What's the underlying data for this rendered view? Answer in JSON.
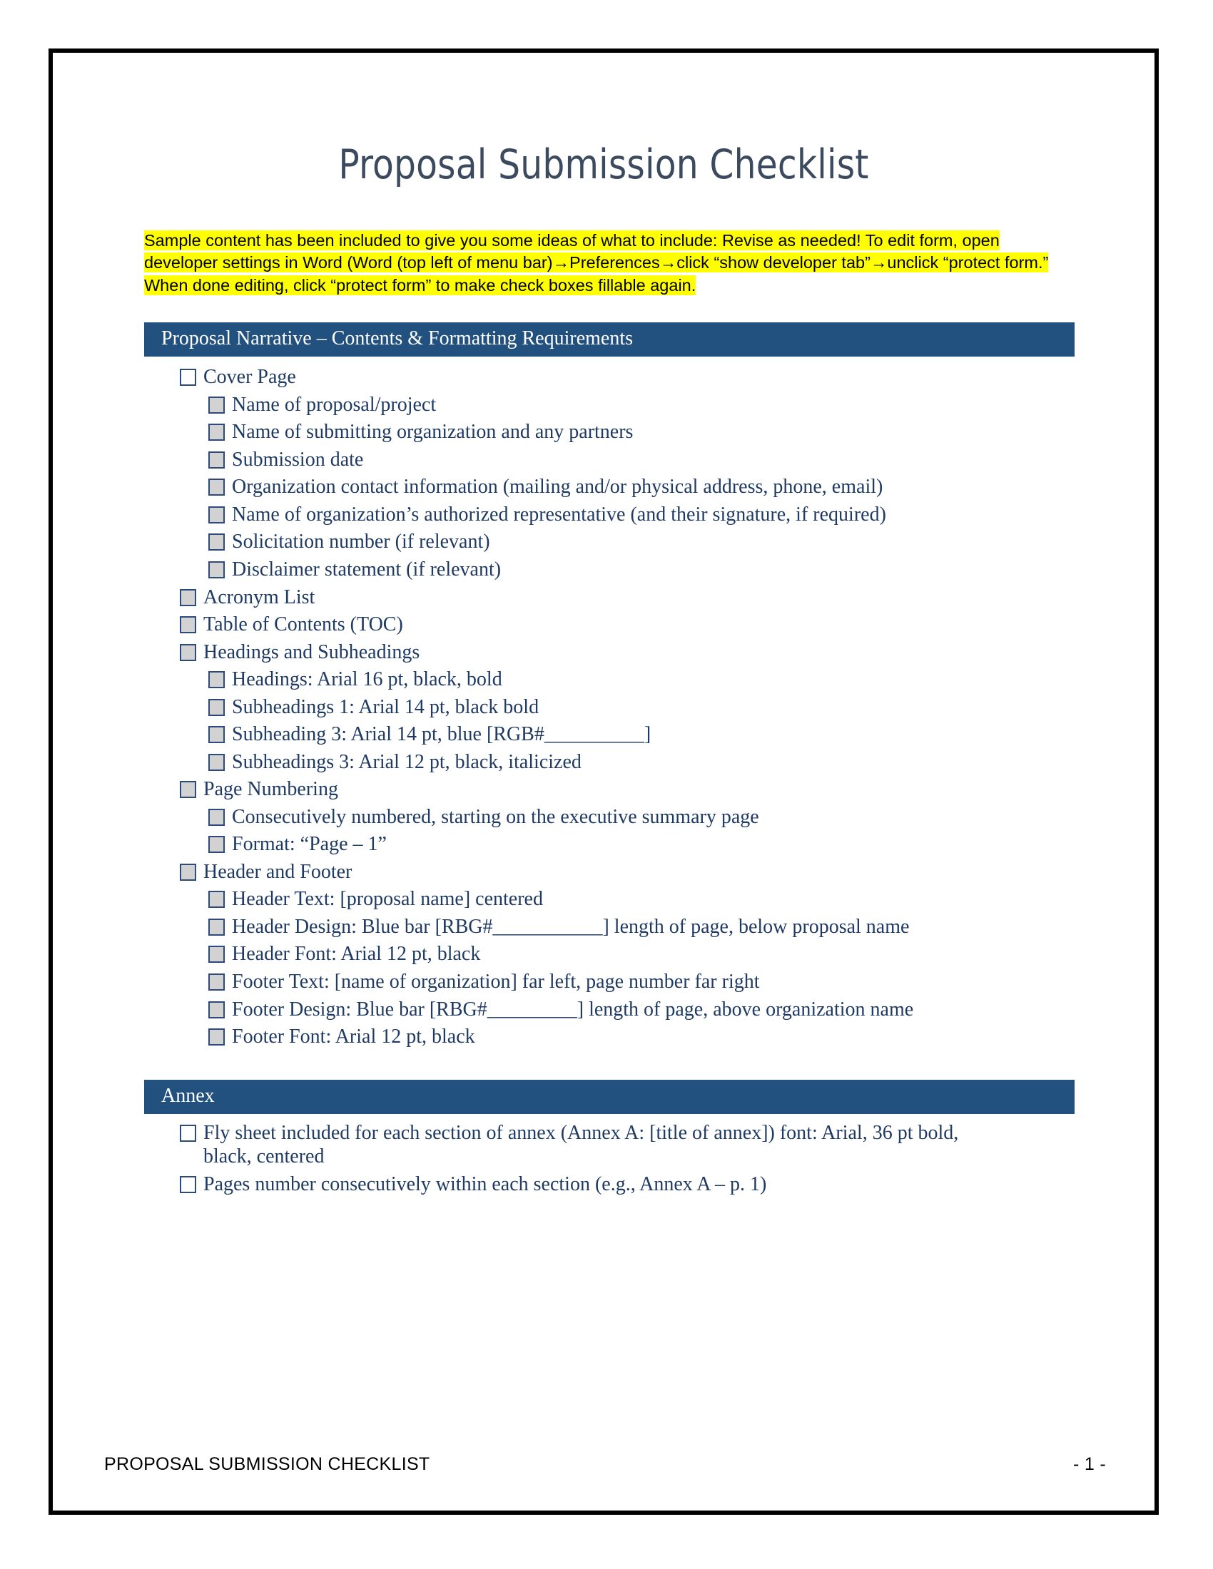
{
  "document": {
    "title": "Proposal Submission Checklist",
    "instruction_note": "Sample content has been included to give you some ideas of what to include: Revise as needed! To edit form, open developer settings in Word (Word (top left of menu bar)→Preferences→click “show developer tab”→unclick “protect form.” When done editing, click “protect form” to make check boxes fillable again.",
    "colors": {
      "section_bar": "#23517f",
      "body_text": "#1f3a63",
      "title_text": "#3b4a5e",
      "highlight": "#ffff00",
      "checkbox_border": "#2c4a7c",
      "checkbox_shaded_fill": "#d2d2d2",
      "page_border": "#000000"
    }
  },
  "sections": [
    {
      "heading": "Proposal Narrative – Contents & Formatting Requirements",
      "items": [
        {
          "level": 1,
          "checkbox": "empty",
          "label": "Cover Page"
        },
        {
          "level": 2,
          "checkbox": "shaded",
          "label": "Name of proposal/project"
        },
        {
          "level": 2,
          "checkbox": "shaded",
          "label": "Name of submitting organization and any partners"
        },
        {
          "level": 2,
          "checkbox": "shaded",
          "label": "Submission date"
        },
        {
          "level": 2,
          "checkbox": "shaded",
          "label": "Organization contact information (mailing and/or physical address, phone, email)"
        },
        {
          "level": 2,
          "checkbox": "shaded",
          "label": "Name of organization’s authorized representative (and their signature, if required)"
        },
        {
          "level": 2,
          "checkbox": "shaded",
          "label": "Solicitation number (if relevant)"
        },
        {
          "level": 2,
          "checkbox": "shaded",
          "label": "Disclaimer statement (if relevant)"
        },
        {
          "level": 1,
          "checkbox": "shaded",
          "label": "Acronym List"
        },
        {
          "level": 1,
          "checkbox": "shaded",
          "label": "Table of Contents (TOC)"
        },
        {
          "level": 1,
          "checkbox": "shaded",
          "label": "Headings and Subheadings"
        },
        {
          "level": 2,
          "checkbox": "shaded",
          "label": "Headings: Arial 16 pt, black, bold"
        },
        {
          "level": 2,
          "checkbox": "shaded",
          "label": "Subheadings 1: Arial 14 pt, black bold"
        },
        {
          "level": 2,
          "checkbox": "shaded",
          "label": "Subheading 3: Arial 14 pt, blue [RGB#__________]"
        },
        {
          "level": 2,
          "checkbox": "shaded",
          "label": "Subheadings 3: Arial 12 pt, black, italicized"
        },
        {
          "level": 1,
          "checkbox": "shaded",
          "label": "Page Numbering"
        },
        {
          "level": 2,
          "checkbox": "shaded",
          "label": "Consecutively numbered, starting on the executive summary page"
        },
        {
          "level": 2,
          "checkbox": "shaded",
          "label": "Format: “Page – 1”"
        },
        {
          "level": 1,
          "checkbox": "shaded",
          "label": "Header and Footer"
        },
        {
          "level": 2,
          "checkbox": "shaded",
          "label": "Header Text: [proposal name] centered"
        },
        {
          "level": 2,
          "checkbox": "shaded",
          "label": "Header Design: Blue bar [RBG#___________] length of page, below proposal name"
        },
        {
          "level": 2,
          "checkbox": "shaded",
          "label": "Header Font: Arial 12 pt, black"
        },
        {
          "level": 2,
          "checkbox": "shaded",
          "label": "Footer Text: [name of organization] far left, page number far right"
        },
        {
          "level": 2,
          "checkbox": "shaded",
          "label": "Footer Design: Blue bar [RBG#_________] length of page, above organization name"
        },
        {
          "level": 2,
          "checkbox": "shaded",
          "label": "Footer Font: Arial 12 pt, black"
        }
      ]
    },
    {
      "heading": "Annex",
      "items": [
        {
          "level": 1,
          "checkbox": "empty",
          "label": "Fly sheet included for each section of annex (Annex A: [title of annex]) font: Arial, 36 pt bold, black, centered"
        },
        {
          "level": 1,
          "checkbox": "empty",
          "label": "Pages number consecutively within each section (e.g., Annex A – p. 1)"
        }
      ]
    }
  ],
  "footer": {
    "left_text": "PROPOSAL SUBMISSION CHECKLIST",
    "page_number": "- 1 -"
  }
}
